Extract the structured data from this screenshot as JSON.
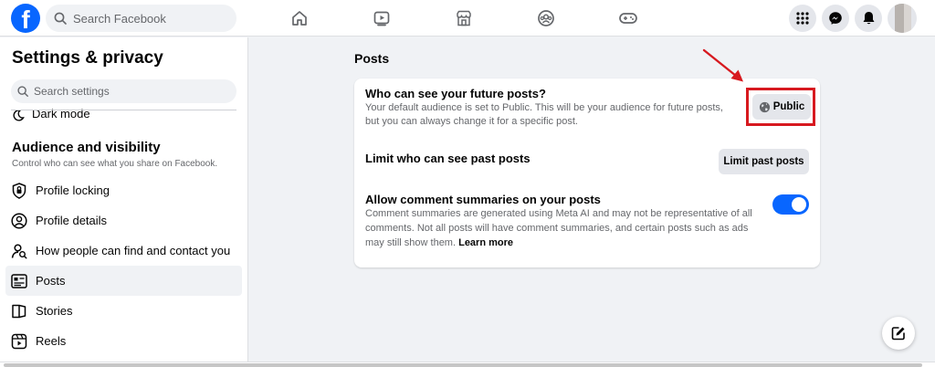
{
  "topbar": {
    "logo_letter": "f",
    "search_placeholder": "Search Facebook",
    "nav_icons": [
      "home-icon",
      "video-icon",
      "marketplace-icon",
      "groups-icon",
      "gaming-icon"
    ],
    "right_icons": [
      "menu-grid-icon",
      "messenger-icon",
      "notifications-icon"
    ],
    "brand_color": "#0866ff"
  },
  "sidebar": {
    "title": "Settings & privacy",
    "search_placeholder": "Search settings",
    "partial_item": "Dark mode",
    "section_title": "Audience and visibility",
    "section_subtitle": "Control who can see what you share on Facebook.",
    "items": [
      {
        "label": "Profile locking",
        "icon": "profile-lock-icon"
      },
      {
        "label": "Profile details",
        "icon": "profile-details-icon"
      },
      {
        "label": "How people can find and contact you",
        "icon": "find-contact-icon"
      },
      {
        "label": "Posts",
        "icon": "posts-icon",
        "active": true
      },
      {
        "label": "Stories",
        "icon": "stories-icon"
      },
      {
        "label": "Reels",
        "icon": "reels-icon"
      }
    ]
  },
  "main": {
    "title": "Posts",
    "rows": {
      "future_posts": {
        "title": "Who can see your future posts?",
        "desc_line1": "Your default audience is set to Public. This will be your audience for future posts,",
        "desc_line2": "but you can always change it for a specific post.",
        "button_label": "Public",
        "button_icon": "globe-icon"
      },
      "past_posts": {
        "title": "Limit who can see past posts",
        "button_label": "Limit past posts"
      },
      "comment_summaries": {
        "title": "Allow comment summaries on your posts",
        "desc_line1": "Comment summaries are generated using Meta AI and may not be representative of all",
        "desc_line2": "comments. Not all posts will have comment summaries, and certain posts such as ads",
        "desc_line3": "may still show them.",
        "learn_more": "Learn more",
        "toggle_on": true
      }
    }
  },
  "annotation": {
    "highlight_color": "#d7191f"
  }
}
